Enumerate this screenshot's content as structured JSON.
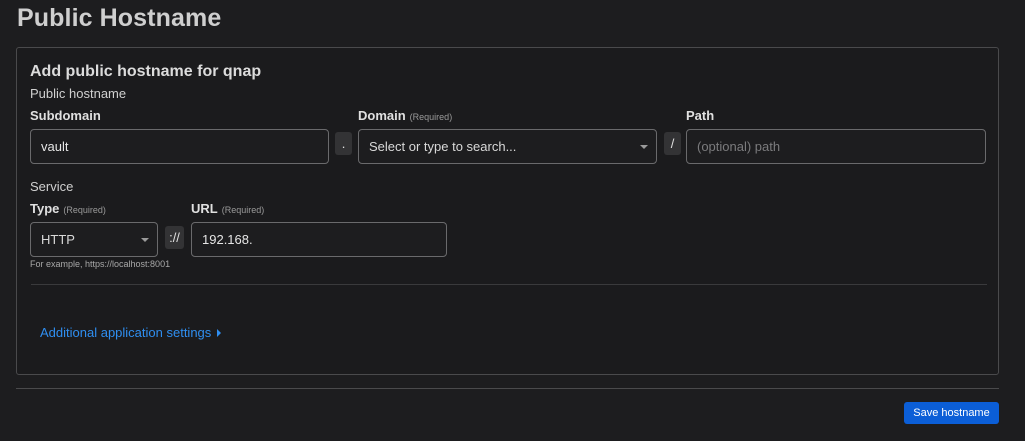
{
  "page": {
    "title": "Public Hostname"
  },
  "card": {
    "title": "Add public hostname for qnap",
    "public_hostname_label": "Public hostname",
    "subdomain": {
      "label": "Subdomain",
      "value": "vault"
    },
    "domain_separator": ".",
    "domain": {
      "label": "Domain",
      "required": "(Required)",
      "placeholder": "Select or type to search..."
    },
    "path_separator": "/",
    "path": {
      "label": "Path",
      "placeholder": "(optional) path"
    },
    "service_label": "Service",
    "type": {
      "label": "Type",
      "required": "(Required)",
      "value": "HTTP"
    },
    "scheme_separator": "://",
    "url": {
      "label": "URL",
      "required": "(Required)",
      "value": "192.168."
    },
    "hint": "For example, https://localhost:8001",
    "additional_settings": "Additional application settings"
  },
  "footer": {
    "save_label": "Save hostname"
  },
  "colors": {
    "accent": "#0b5ed7",
    "link": "#2f8ef0",
    "background": "#1d1d1f"
  }
}
